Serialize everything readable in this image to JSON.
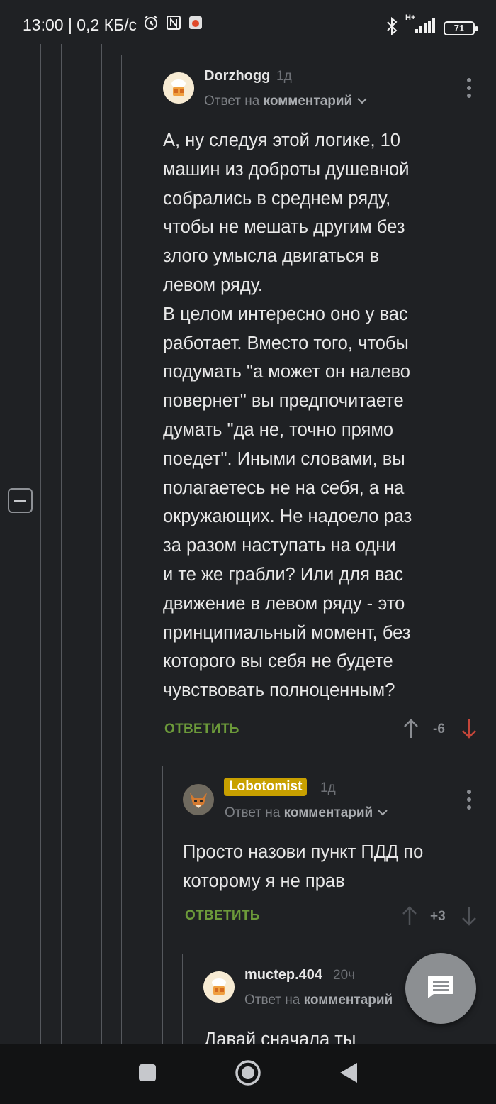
{
  "status_bar": {
    "time_speed": "13:00 | 0,2 КБ/с",
    "network": "H+",
    "battery": "71"
  },
  "comments": [
    {
      "username": "Dorzhogg",
      "time": "1д",
      "reply_prefix": "Ответ на",
      "reply_link": "комментарий",
      "body": "А, ну следуя этой логике, 10\nмашин из доброты душевной\nсобрались в среднем ряду,\nчтобы не мешать другим без\nзлого умысла двигаться в\nлевом ряду.\nВ целом интересно оно у вас\nработает. Вместо того, чтобы\nподумать \"а может он налево\nповернет\" вы предпочитаете\nдумать \"да не, точно прямо\nпоедет\". Иными словами, вы\nполагаетесь не на себя, а на\nокружающих. Не надоело раз\nза разом наступать на одни\nи те же грабли? Или для вас\nдвижение в левом ряду - это\nпринципиальный момент, без\nкоторого вы себя не будете\nчувствовать полноценным?",
      "reply_label": "ОТВЕТИТЬ",
      "rating": "-6"
    },
    {
      "username": "Lobotomist",
      "time": "1д",
      "reply_prefix": "Ответ на",
      "reply_link": "комментарий",
      "body": "Просто назови пункт ПДД по\nкоторому я не прав",
      "reply_label": "ОТВЕТИТЬ",
      "rating": "+3"
    },
    {
      "username": "muctep.404",
      "time": "20ч",
      "reply_prefix": "Ответ на",
      "reply_link": "комментарий",
      "body": "Давай сначала ты"
    }
  ],
  "colors": {
    "background": "#1f2124",
    "reply_green": "#6c9a3a",
    "downvote_red": "#c4463a",
    "badge_gold": "#c8a000"
  },
  "icons": [
    "alarm-icon",
    "nfc-icon",
    "app-notification-icon",
    "bluetooth-icon",
    "signal-icon",
    "battery-icon",
    "more-icon",
    "chevron-down-icon",
    "upvote-arrow-icon",
    "downvote-arrow-icon",
    "collapse-icon",
    "comment-icon",
    "nav-square-icon",
    "nav-circle-icon",
    "nav-back-icon"
  ]
}
